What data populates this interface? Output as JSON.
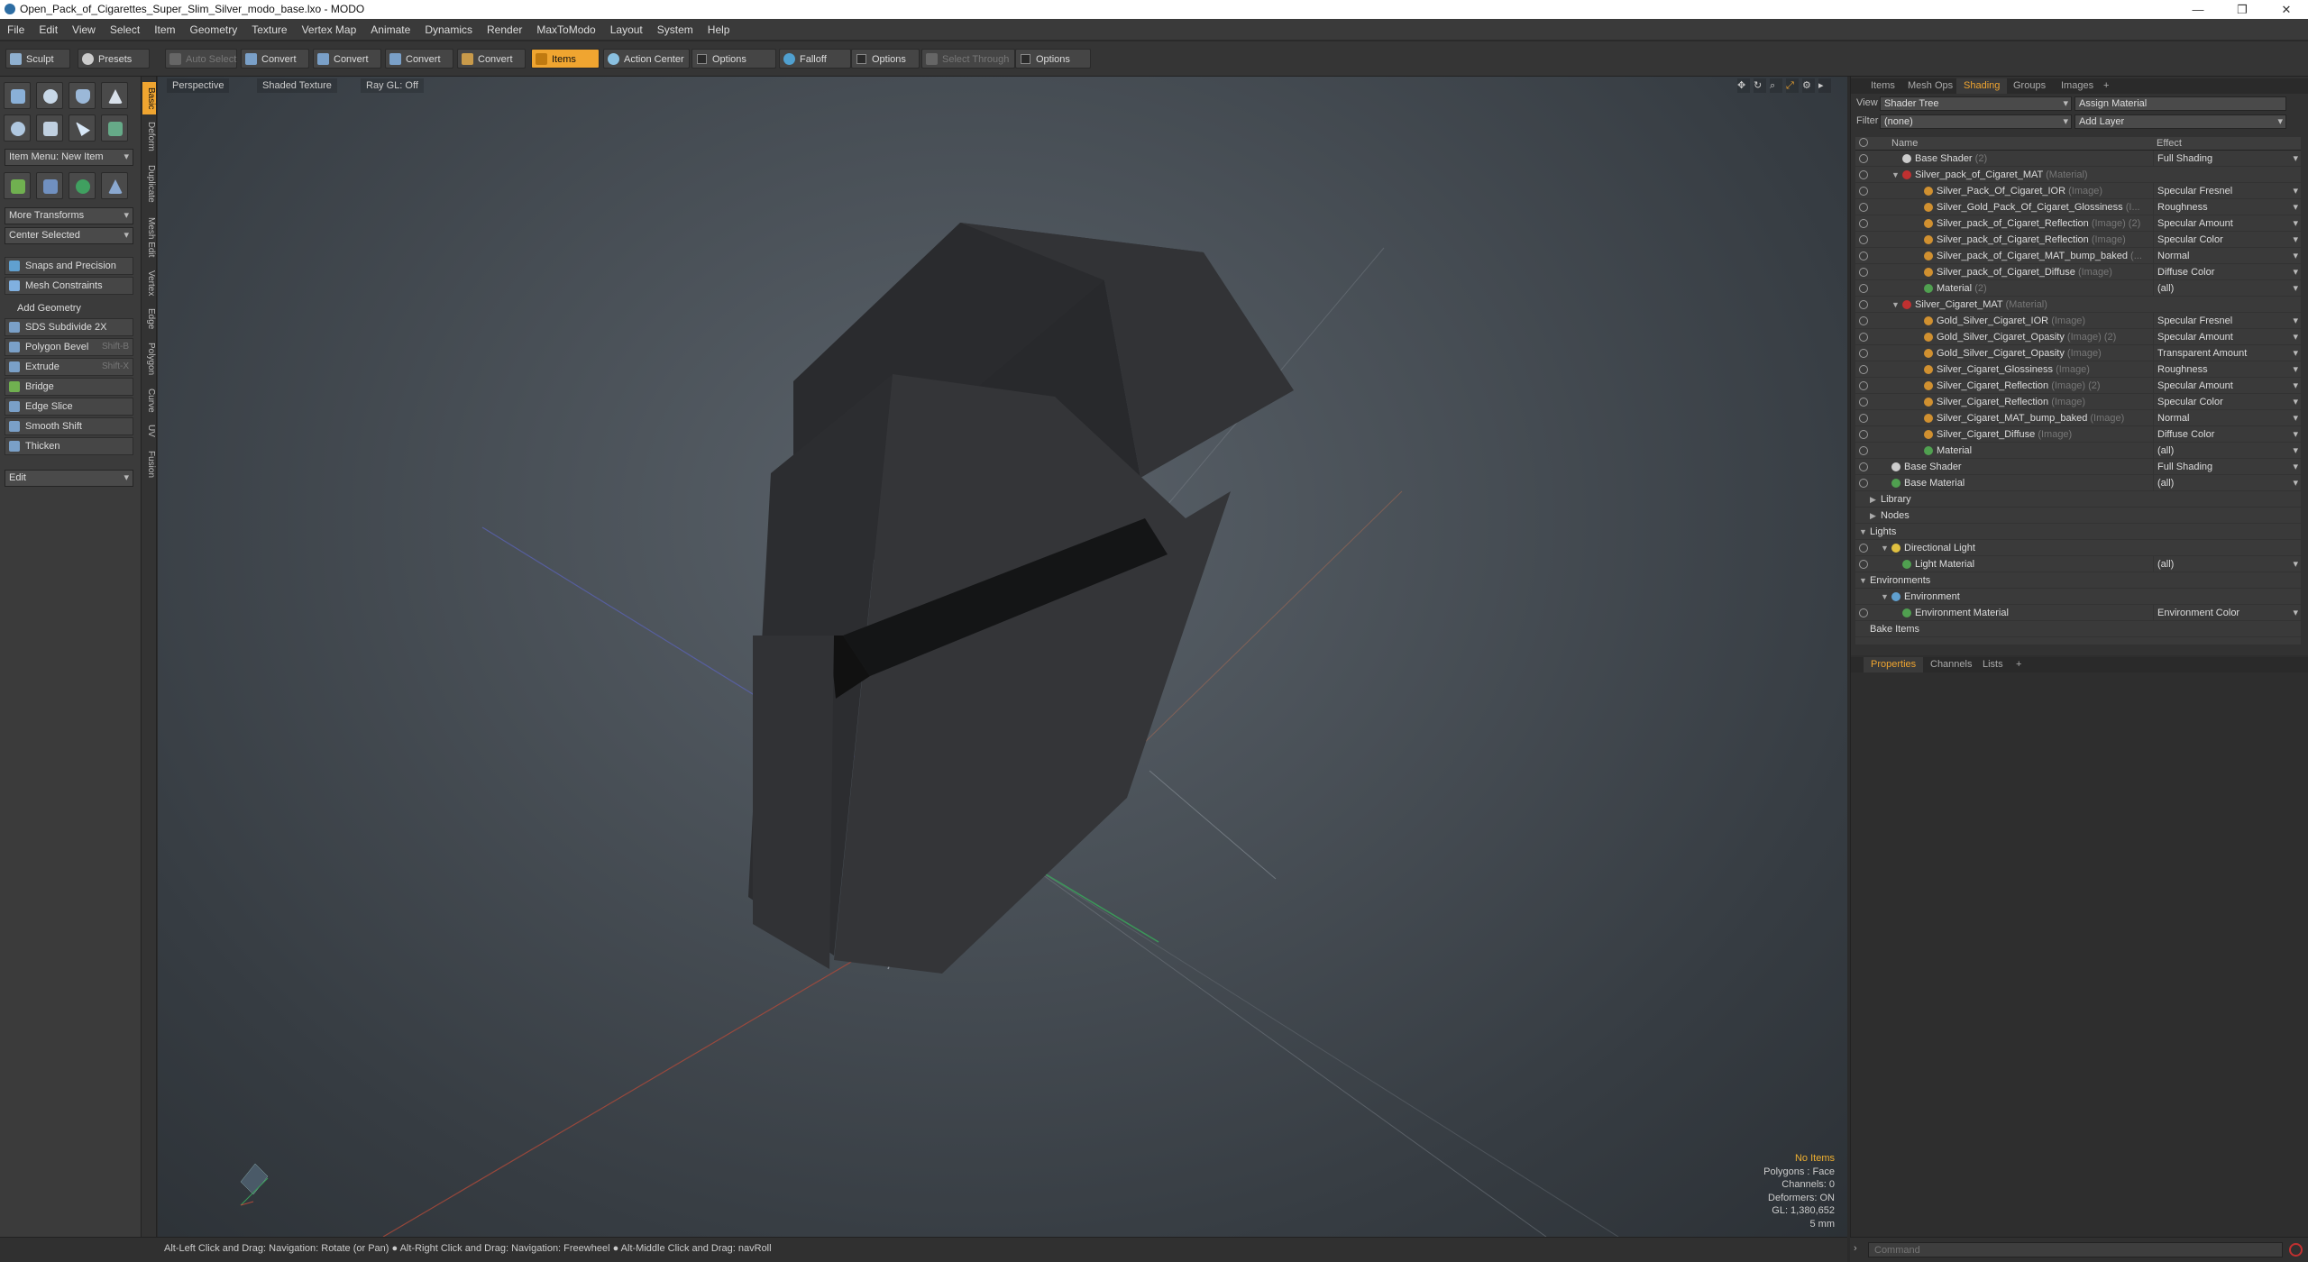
{
  "window": {
    "title": "Open_Pack_of_Cigarettes_Super_Slim_Silver_modo_base.lxo - MODO",
    "minimize": "—",
    "maximize": "❐",
    "close": "✕"
  },
  "menu": [
    "File",
    "Edit",
    "View",
    "Select",
    "Item",
    "Geometry",
    "Texture",
    "Vertex Map",
    "Animate",
    "Dynamics",
    "Render",
    "MaxToModo",
    "Layout",
    "System",
    "Help"
  ],
  "toolbar": {
    "sculpt": "Sculpt",
    "presets": "Presets",
    "auto_select": "Auto Select",
    "convert1": "Convert",
    "convert2": "Convert",
    "convert3": "Convert",
    "convert4": "Convert",
    "items": "Items",
    "action_center": "Action Center",
    "options1": "Options",
    "falloff": "Falloff",
    "options2": "Options",
    "select_through": "Select Through",
    "options3": "Options"
  },
  "left": {
    "item_menu": "Item Menu: New Item",
    "more_transforms": "More Transforms",
    "center_selected": "Center Selected",
    "snaps": "Snaps and Precision",
    "mesh_constraints": "Mesh Constraints",
    "add_geometry": "Add Geometry",
    "sds": "SDS Subdivide 2X",
    "polygon_bevel": "Polygon Bevel",
    "polygon_bevel_sc": "Shift-B",
    "extrude": "Extrude",
    "extrude_sc": "Shift-X",
    "bridge": "Bridge",
    "edge_slice": "Edge Slice",
    "smooth_shift": "Smooth Shift",
    "thicken": "Thicken",
    "edit": "Edit",
    "vtabs": [
      "Basic",
      "Deform",
      "Duplicate",
      "Mesh Edit",
      "Vertex",
      "Edge",
      "Polygon",
      "Curve",
      "UV",
      "Fusion"
    ]
  },
  "viewport": {
    "perspective": "Perspective",
    "shaded": "Shaded Texture",
    "raygl": "Ray GL: Off",
    "info": {
      "no_items": "No Items",
      "polygons": "Polygons : Face",
      "channels": "Channels: 0",
      "deformers": "Deformers: ON",
      "gl": "GL: 1,380,652",
      "unit": "5 mm"
    }
  },
  "status": "Alt-Left Click and Drag: Navigation: Rotate (or Pan) ● Alt-Right Click and Drag: Navigation: Freewheel ● Alt-Middle Click and Drag: navRoll",
  "right": {
    "tabs": [
      "Items",
      "Mesh Ops",
      "Shading",
      "Groups",
      "Images",
      "+"
    ],
    "view_label": "View",
    "view_value": "Shader Tree",
    "assign": "Assign Material",
    "filter_label": "Filter",
    "filter_value": "(none)",
    "add_layer": "Add Layer",
    "col_name": "Name",
    "col_effect": "Effect",
    "rows": [
      {
        "name": "Base Shader",
        "sfx": "(2)",
        "effect": "Full Shading",
        "indent": 1,
        "icon": "#cccccc",
        "eye": true,
        "dd": true
      },
      {
        "name": "Silver_pack_of_Cigaret_MAT",
        "sfx": "(Material)",
        "effect": "",
        "indent": 1,
        "icon": "#c03030",
        "eye": true,
        "tw": "▼"
      },
      {
        "name": "Silver_Pack_Of_Cigaret_IOR",
        "sfx": "(Image)",
        "effect": "Specular Fresnel",
        "indent": 3,
        "icon": "#d09030",
        "eye": true,
        "dd": true
      },
      {
        "name": "Silver_Gold_Pack_Of_Cigaret_Glossiness",
        "sfx": "(I...",
        "effect": "Roughness",
        "indent": 3,
        "icon": "#d09030",
        "eye": true,
        "dd": true
      },
      {
        "name": "Silver_pack_of_Cigaret_Reflection",
        "sfx": "(Image) (2)",
        "effect": "Specular Amount",
        "indent": 3,
        "icon": "#d09030",
        "eye": true,
        "dd": true
      },
      {
        "name": "Silver_pack_of_Cigaret_Reflection",
        "sfx": "(Image)",
        "effect": "Specular Color",
        "indent": 3,
        "icon": "#d09030",
        "eye": true,
        "dd": true
      },
      {
        "name": "Silver_pack_of_Cigaret_MAT_bump_baked",
        "sfx": "(...",
        "effect": "Normal",
        "indent": 3,
        "icon": "#d09030",
        "eye": true,
        "dd": true
      },
      {
        "name": "Silver_pack_of_Cigaret_Diffuse",
        "sfx": "(Image)",
        "effect": "Diffuse Color",
        "indent": 3,
        "icon": "#d09030",
        "eye": true,
        "dd": true
      },
      {
        "name": "Material",
        "sfx": "(2)",
        "effect": "(all)",
        "indent": 3,
        "icon": "#50a050",
        "eye": true,
        "dd": true
      },
      {
        "name": "Silver_Cigaret_MAT",
        "sfx": "(Material)",
        "effect": "",
        "indent": 1,
        "icon": "#c03030",
        "eye": true,
        "tw": "▼"
      },
      {
        "name": "Gold_Silver_Cigaret_IOR",
        "sfx": "(Image)",
        "effect": "Specular Fresnel",
        "indent": 3,
        "icon": "#d09030",
        "eye": true,
        "dd": true
      },
      {
        "name": "Gold_Silver_Cigaret_Opasity",
        "sfx": "(Image) (2)",
        "effect": "Specular Amount",
        "indent": 3,
        "icon": "#d09030",
        "eye": true,
        "dd": true
      },
      {
        "name": "Gold_Silver_Cigaret_Opasity",
        "sfx": "(Image)",
        "effect": "Transparent Amount",
        "indent": 3,
        "icon": "#d09030",
        "eye": true,
        "dd": true
      },
      {
        "name": "Silver_Cigaret_Glossiness",
        "sfx": "(Image)",
        "effect": "Roughness",
        "indent": 3,
        "icon": "#d09030",
        "eye": true,
        "dd": true
      },
      {
        "name": "Silver_Cigaret_Reflection",
        "sfx": "(Image) (2)",
        "effect": "Specular Amount",
        "indent": 3,
        "icon": "#d09030",
        "eye": true,
        "dd": true
      },
      {
        "name": "Silver_Cigaret_Reflection",
        "sfx": "(Image)",
        "effect": "Specular Color",
        "indent": 3,
        "icon": "#d09030",
        "eye": true,
        "dd": true
      },
      {
        "name": "Silver_Cigaret_MAT_bump_baked",
        "sfx": "(Image)",
        "effect": "Normal",
        "indent": 3,
        "icon": "#d09030",
        "eye": true,
        "dd": true
      },
      {
        "name": "Silver_Cigaret_Diffuse",
        "sfx": "(Image)",
        "effect": "Diffuse Color",
        "indent": 3,
        "icon": "#d09030",
        "eye": true,
        "dd": true
      },
      {
        "name": "Material",
        "sfx": "",
        "effect": "(all)",
        "indent": 3,
        "icon": "#50a050",
        "eye": true,
        "dd": true
      },
      {
        "name": "Base Shader",
        "sfx": "",
        "effect": "Full Shading",
        "indent": 0,
        "icon": "#cccccc",
        "eye": true,
        "dd": true
      },
      {
        "name": "Base Material",
        "sfx": "",
        "effect": "(all)",
        "indent": 0,
        "icon": "#50a050",
        "eye": true,
        "dd": true
      },
      {
        "name": "Library",
        "sfx": "",
        "effect": "",
        "indent": -1,
        "icon": "",
        "eye": false,
        "tw": "▶"
      },
      {
        "name": "Nodes",
        "sfx": "",
        "effect": "",
        "indent": -1,
        "icon": "",
        "eye": false,
        "tw": "▶"
      },
      {
        "name": "Lights",
        "sfx": "",
        "effect": "",
        "indent": -2,
        "icon": "",
        "eye": false,
        "tw": "▼"
      },
      {
        "name": "Directional Light",
        "sfx": "",
        "effect": "",
        "indent": 0,
        "icon": "#e0c040",
        "eye": true,
        "tw": "▼"
      },
      {
        "name": "Light Material",
        "sfx": "",
        "effect": "(all)",
        "indent": 1,
        "icon": "#50a050",
        "eye": true,
        "dd": true
      },
      {
        "name": "Environments",
        "sfx": "",
        "effect": "",
        "indent": -2,
        "icon": "",
        "eye": false,
        "tw": "▼"
      },
      {
        "name": "Environment",
        "sfx": "",
        "effect": "",
        "indent": 0,
        "icon": "#60a0d0",
        "eye": false,
        "tw": "▼"
      },
      {
        "name": "Environment Material",
        "sfx": "",
        "effect": "Environment Color",
        "indent": 1,
        "icon": "#50a050",
        "eye": true,
        "dd": true
      },
      {
        "name": "Bake Items",
        "sfx": "",
        "effect": "",
        "indent": -2,
        "icon": "",
        "eye": false
      }
    ],
    "ptabs": [
      "Properties",
      "Channels",
      "Lists",
      "+"
    ],
    "command_placeholder": "Command"
  },
  "colors": {
    "accent": "#f0a530"
  }
}
